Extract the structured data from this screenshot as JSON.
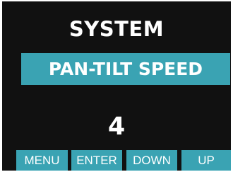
{
  "screen": {
    "title": "SYSTEM",
    "selected_item": "PAN-TILT SPEED",
    "value": "4"
  },
  "softkeys": {
    "menu": "MENU",
    "enter": "ENTER",
    "down": "DOWN",
    "up": "UP"
  },
  "colors": {
    "background": "#111111",
    "accent": "#3aa3b3",
    "text": "#ffffff"
  }
}
